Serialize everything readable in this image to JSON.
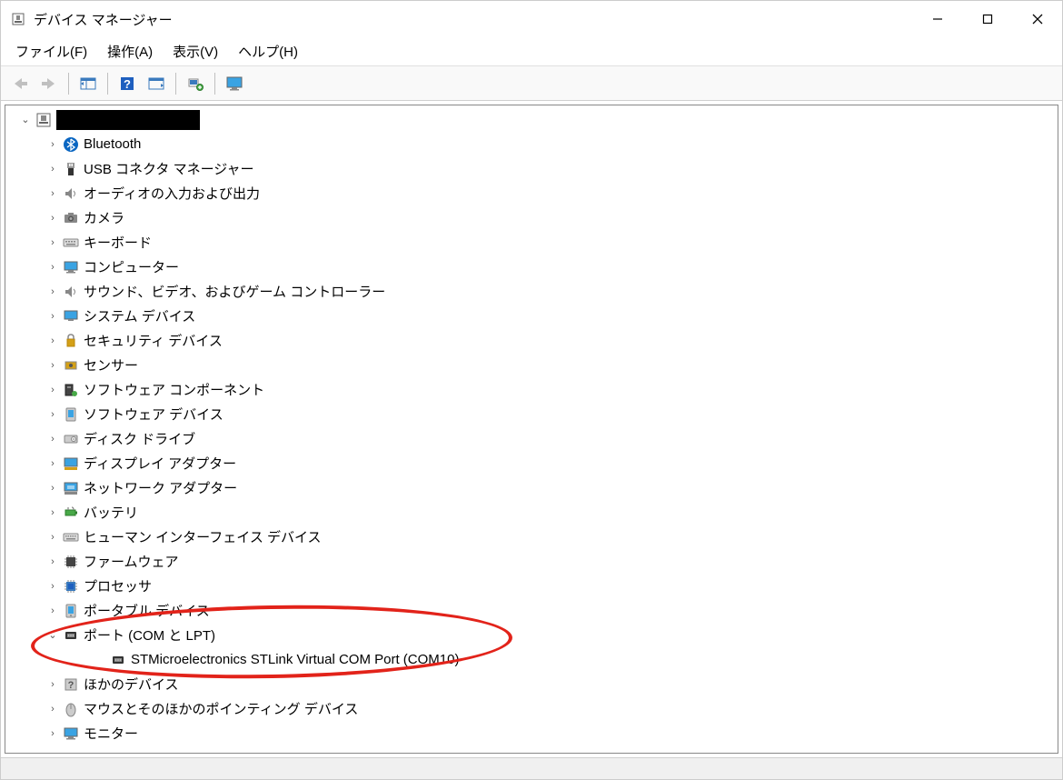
{
  "window": {
    "title": "デバイス マネージャー"
  },
  "menu": {
    "file": "ファイル(F)",
    "action": "操作(A)",
    "view": "表示(V)",
    "help": "ヘルプ(H)"
  },
  "tree": {
    "root": "",
    "bluetooth": "Bluetooth",
    "usb_connector": "USB コネクタ マネージャー",
    "audio": "オーディオの入力および出力",
    "camera": "カメラ",
    "keyboard": "キーボード",
    "computer": "コンピューター",
    "sound_video_game": "サウンド、ビデオ、およびゲーム コントローラー",
    "system_devices": "システム デバイス",
    "security_devices": "セキュリティ デバイス",
    "sensor": "センサー",
    "software_components": "ソフトウェア コンポーネント",
    "software_devices": "ソフトウェア デバイス",
    "disk_drives": "ディスク ドライブ",
    "display_adapters": "ディスプレイ アダプター",
    "network_adapters": "ネットワーク アダプター",
    "battery": "バッテリ",
    "hid": "ヒューマン インターフェイス デバイス",
    "firmware": "ファームウェア",
    "processor": "プロセッサ",
    "portable_devices": "ポータブル デバイス",
    "ports": "ポート (COM と LPT)",
    "ports_child": "STMicroelectronics STLink Virtual COM Port (COM10)",
    "other_devices": "ほかのデバイス",
    "mouse": "マウスとそのほかのポインティング デバイス",
    "monitor": "モニター"
  }
}
